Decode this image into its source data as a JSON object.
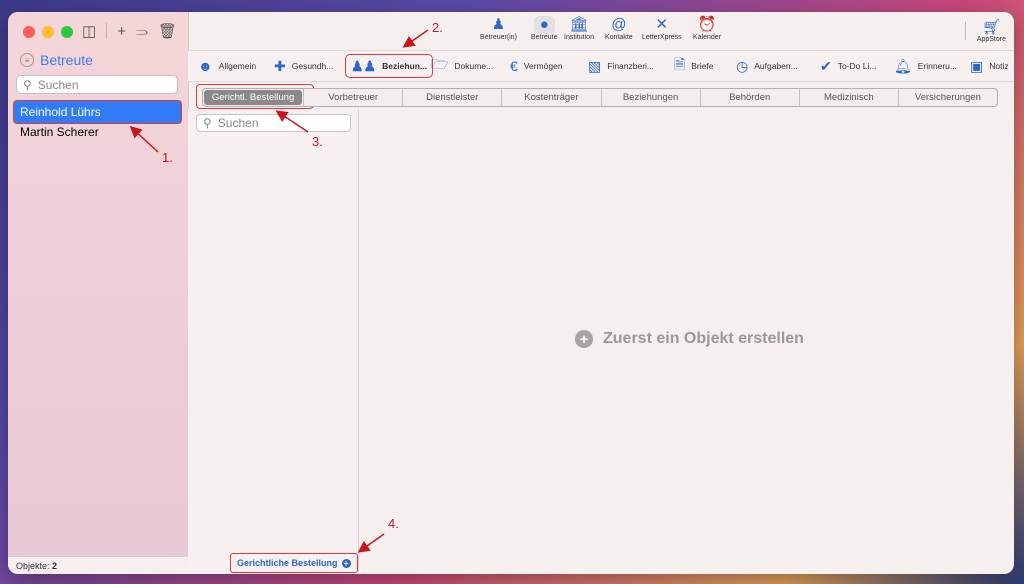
{
  "sidebar": {
    "title": "Betreute",
    "search_placeholder": "Suchen",
    "items": [
      {
        "label": "Reinhold Lührs",
        "selected": true
      },
      {
        "label": "Martin Scherer",
        "selected": false
      }
    ],
    "footer_label": "Objekte:",
    "footer_count": "2"
  },
  "toolbar": {
    "buttons": [
      {
        "label": "Betreuer(in)",
        "icon": "person-badge-icon"
      },
      {
        "label": "Betreute",
        "icon": "person-icon"
      },
      {
        "label": "Institution",
        "icon": "bank-icon"
      },
      {
        "label": "Kontakte",
        "icon": "at-icon"
      },
      {
        "label": "LetterXpress",
        "icon": "x-logo-icon"
      },
      {
        "label": "Kalender",
        "icon": "alarm-icon"
      }
    ],
    "appstore_label": "AppStore"
  },
  "tabs": [
    {
      "label": "Allgemein",
      "icon": "person-outline-icon"
    },
    {
      "label": "Gesundh...",
      "icon": "medical-kit-icon"
    },
    {
      "label": "Beziehun...",
      "icon": "people-icon"
    },
    {
      "label": "Dokume...",
      "icon": "folder-icon"
    },
    {
      "label": "Vermögen",
      "icon": "euro-icon"
    },
    {
      "label": "Finanzberi...",
      "icon": "chart-icon"
    },
    {
      "label": "Briefe",
      "icon": "document-icon"
    },
    {
      "label": "Aufgaben...",
      "icon": "clock-check-icon"
    },
    {
      "label": "To-Do Li...",
      "icon": "checkmark-circle-icon"
    },
    {
      "label": "Erinneru...",
      "icon": "bell-icon"
    },
    {
      "label": "Notiz",
      "icon": "note-icon"
    }
  ],
  "segments": [
    "Gerichtl. Bestellung",
    "Vorbetreuer",
    "Dienstleister",
    "Kostenträger",
    "Beziehungen",
    "Behörden",
    "Medizinisch",
    "Versicherungen"
  ],
  "list": {
    "search_placeholder": "Suchen",
    "add_button_label": "Gerichtliche Bestellung"
  },
  "empty_state": "Zuerst ein Objekt erstellen",
  "annotations": [
    "1.",
    "2.",
    "3.",
    "4."
  ],
  "colors": {
    "accent": "#2f7cf6",
    "annotation": "#c9161b"
  }
}
